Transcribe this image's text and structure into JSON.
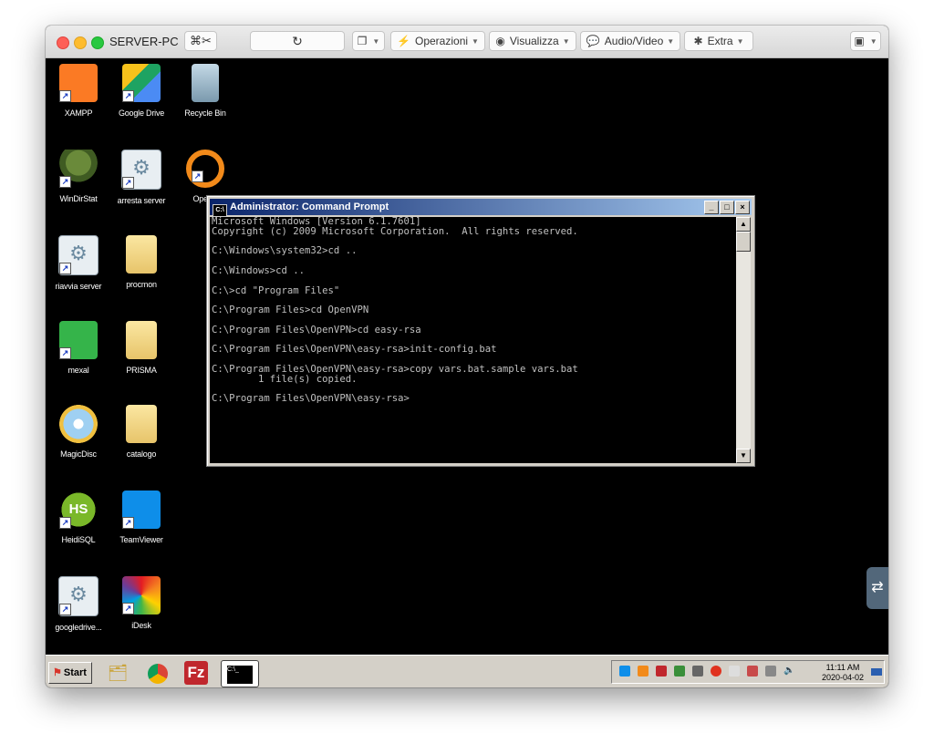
{
  "window": {
    "title": "SERVER-PC",
    "toolbar": {
      "operations": "Operazioni",
      "view": "Visualizza",
      "audio_video": "Audio/Video",
      "extra": "Extra"
    }
  },
  "desktop": {
    "icons": [
      {
        "label": "XAMPP",
        "icon": "xampp-icon"
      },
      {
        "label": "Google Drive",
        "icon": "google-drive-icon"
      },
      {
        "label": "Recycle Bin",
        "icon": "recycle-bin-icon"
      },
      {
        "label": "WinDirStat",
        "icon": "windirstat-icon"
      },
      {
        "label": "arresta server",
        "icon": "settings-shortcut-icon"
      },
      {
        "label": "OpenV",
        "icon": "openvpn-icon"
      },
      {
        "label": "riavvia server",
        "icon": "settings-shortcut-icon"
      },
      {
        "label": "procmon",
        "icon": "folder-icon"
      },
      {
        "label": "mexal",
        "icon": "mexal-icon"
      },
      {
        "label": "PRISMA",
        "icon": "folder-icon"
      },
      {
        "label": "MagicDisc",
        "icon": "magicdisc-icon"
      },
      {
        "label": "catalogo",
        "icon": "folder-icon"
      },
      {
        "label": "HeidiSQL",
        "icon": "heidisql-icon"
      },
      {
        "label": "TeamViewer",
        "icon": "teamviewer-icon"
      },
      {
        "label": "googledrive...",
        "icon": "settings-shortcut-icon"
      },
      {
        "label": "iDesk",
        "icon": "idesk-icon"
      }
    ]
  },
  "cmd": {
    "title": "Administrator: Command Prompt",
    "text": "Microsoft Windows [Version 6.1.7601]\nCopyright (c) 2009 Microsoft Corporation.  All rights reserved.\n\nC:\\Windows\\system32>cd ..\n\nC:\\Windows>cd ..\n\nC:\\>cd \"Program Files\"\n\nC:\\Program Files>cd OpenVPN\n\nC:\\Program Files\\OpenVPN>cd easy-rsa\n\nC:\\Program Files\\OpenVPN\\easy-rsa>init-config.bat\n\nC:\\Program Files\\OpenVPN\\easy-rsa>copy vars.bat.sample vars.bat\n        1 file(s) copied.\n\nC:\\Program Files\\OpenVPN\\easy-rsa>"
  },
  "taskbar": {
    "start": "Start",
    "clock_time": "11:11 AM",
    "clock_date": "2020-04-02"
  },
  "colors": {
    "desktop_bg": "#000000",
    "cmd_title_start": "#0a246a",
    "cmd_title_end": "#a6caf0",
    "taskbar_bg": "#d4d0c8"
  }
}
